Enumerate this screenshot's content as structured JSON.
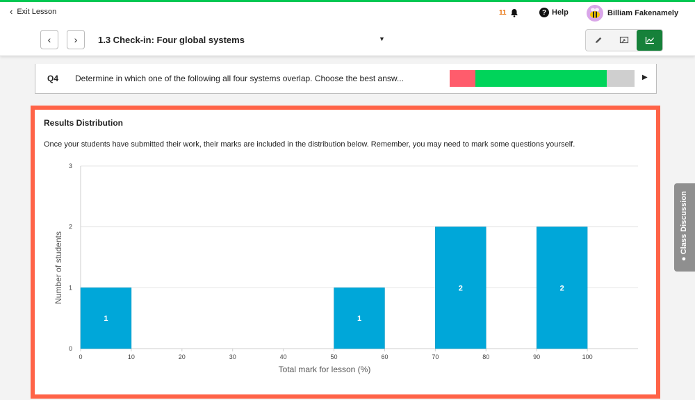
{
  "topbar": {
    "exit_label": "Exit Lesson",
    "notification_count": "11",
    "help_label": "Help",
    "user_name": "Billiam Fakenamely"
  },
  "lesson": {
    "title": "1.3 Check-in: Four global systems",
    "tools": [
      "pencil-icon",
      "present-icon",
      "chart-icon"
    ]
  },
  "question": {
    "number": "Q4",
    "text": "Determine in which one of the following all four systems overlap. Choose the best answ...",
    "result_fractions": [
      {
        "name": "incorrect",
        "fraction": 0.14,
        "color": "#ff5c6c"
      },
      {
        "name": "correct",
        "fraction": 0.71,
        "color": "#00d45a"
      },
      {
        "name": "unanswered",
        "fraction": 0.15,
        "color": "#cfcfcf"
      }
    ]
  },
  "results": {
    "title": "Results Distribution",
    "description": "Once your students have submitted their work, their marks are included in the distribution below. Remember, you may need to mark some questions yourself."
  },
  "chart_data": {
    "type": "bar",
    "x": [
      5,
      55,
      75,
      95
    ],
    "bin_width": 10,
    "values": [
      1,
      1,
      2,
      2
    ],
    "data_labels": [
      "1",
      "1",
      "2",
      "2"
    ],
    "xlabel": "Total mark for lesson (%)",
    "ylabel": "Number of students",
    "xlim": [
      0,
      110
    ],
    "ylim": [
      0,
      3
    ],
    "xticks": [
      "0",
      "10",
      "20",
      "30",
      "40",
      "50",
      "60",
      "70",
      "80",
      "90",
      "100"
    ],
    "yticks": [
      "0",
      "1",
      "2",
      "3"
    ],
    "grid": true,
    "bar_color": "#00a7d9"
  },
  "side_tab": {
    "label": "Class Discussion"
  }
}
